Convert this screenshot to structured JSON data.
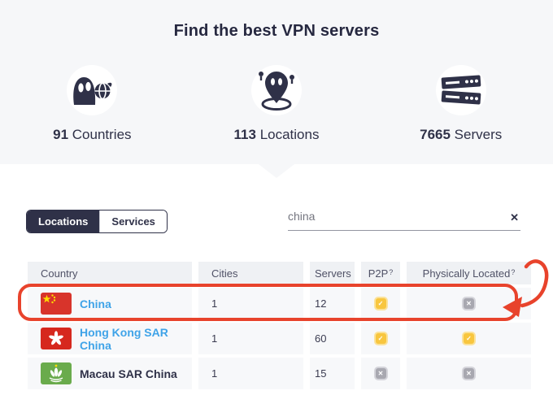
{
  "hero": {
    "title": "Find the best VPN servers",
    "stats": [
      {
        "icon": "ghost-icon",
        "value": "91",
        "label": " Countries"
      },
      {
        "icon": "locations-icon",
        "value": "113",
        "label": " Locations"
      },
      {
        "icon": "servers-icon",
        "value": "7665",
        "label": " Servers"
      }
    ]
  },
  "toolbar": {
    "tabs": [
      {
        "label": "Locations",
        "active": true
      },
      {
        "label": "Services",
        "active": false
      }
    ],
    "search": {
      "value": "china",
      "clear_icon": "✕"
    }
  },
  "table": {
    "columns": [
      {
        "label": "Country"
      },
      {
        "label": "Cities"
      },
      {
        "label": "Servers"
      },
      {
        "label": "P2P",
        "help_mark": "?"
      },
      {
        "label": "Physically Located",
        "help_mark": "?"
      }
    ],
    "rows": [
      {
        "country": "China",
        "flag": "china-flag",
        "link": true,
        "cities": "1",
        "servers": "12",
        "p2p": "yes",
        "located": "no"
      },
      {
        "country": "Hong Kong SAR China",
        "flag": "hong-kong-flag",
        "link": true,
        "cities": "1",
        "servers": "60",
        "p2p": "yes",
        "located": "yes"
      },
      {
        "country": "Macau SAR China",
        "flag": "macau-flag",
        "link": false,
        "cities": "1",
        "servers": "15",
        "p2p": "no",
        "located": "no"
      }
    ]
  },
  "annotation": {
    "shape": "rounded-rect-with-curved-arrow",
    "highlighted_row": "China",
    "color": "#e8432c"
  },
  "colors": {
    "hero_bg": "#f6f7f9",
    "navy": "#2f3148",
    "link_blue": "#3fa3e8",
    "yes_yellow": "#f8c63f",
    "no_gray": "#a8a8b0",
    "annotation_red": "#e8432c"
  }
}
